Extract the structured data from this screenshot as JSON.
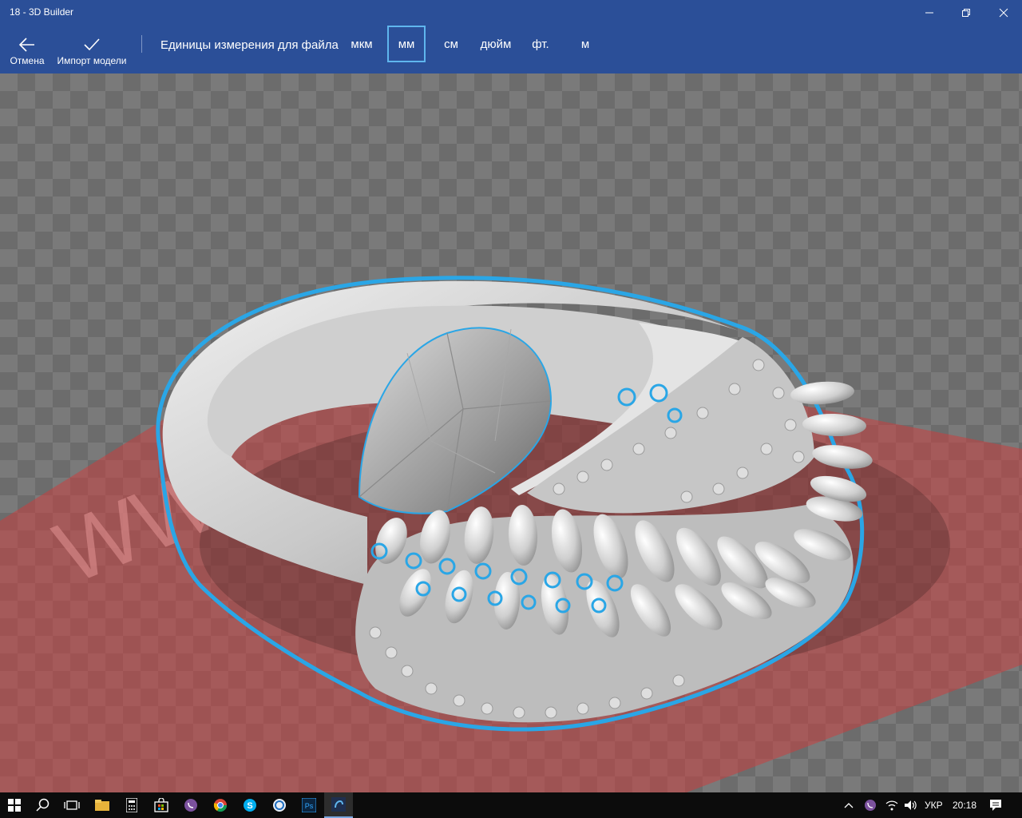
{
  "window": {
    "title": "18 - 3D Builder"
  },
  "commands": {
    "cancel_label": "Отмена",
    "import_label": "Импорт модели"
  },
  "units": {
    "label": "Единицы измерения для файла",
    "options": [
      "мкм",
      "мм",
      "см",
      "дюйм",
      "фт.",
      "м"
    ],
    "selected": "мм"
  },
  "viewport": {
    "watermark": "WW",
    "colors": {
      "floor": "#c8403f",
      "outline": "#2aa6e6",
      "model": "#d6d6d6"
    }
  },
  "taskbar": {
    "language": "УКР",
    "time": "20:18",
    "icons": [
      "windows-start-icon",
      "search-icon",
      "task-view-icon",
      "file-explorer-icon",
      "calculator-icon",
      "store-icon",
      "viber-icon",
      "chrome-icon",
      "skype-icon",
      "app-icon",
      "photoshop-icon",
      "3d-builder-icon"
    ]
  },
  "colors": {
    "accent": "#2b4f98",
    "selection_border": "#5fb6ee",
    "taskbar": "#0c0c0c"
  }
}
